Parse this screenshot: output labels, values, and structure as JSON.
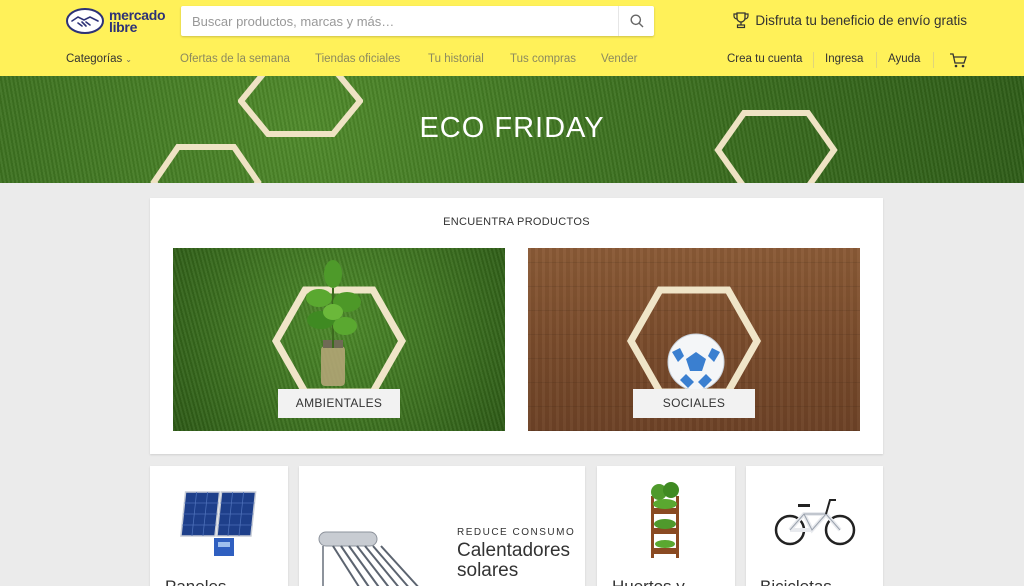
{
  "header": {
    "logo_line1": "mercado",
    "logo_line2": "libre",
    "search_placeholder": "Buscar productos, marcas y más…",
    "promo_text": "Disfruta tu beneficio de envío gratis"
  },
  "nav": {
    "categories_label": "Categorías",
    "links": [
      "Ofertas de la semana",
      "Tiendas oficiales",
      "Tu historial",
      "Tus compras",
      "Vender"
    ],
    "right_links": [
      "Crea tu cuenta",
      "Ingresa",
      "Ayuda"
    ]
  },
  "banner": {
    "title": "ECO FRIDAY"
  },
  "find": {
    "title": "ENCUENTRA PRODUCTOS",
    "tiles": [
      {
        "label": "AMBIENTALES"
      },
      {
        "label": "SOCIALES"
      }
    ]
  },
  "products": {
    "panels_label": "Paneles",
    "heaters_kicker": "REDUCE CONSUMO",
    "heaters_line1": "Calentadores",
    "heaters_line2": "solares",
    "gardens_label": "Huertos y",
    "bikes_label": "Bicicletas"
  },
  "colors": {
    "header_bg": "#fff159",
    "brand_blue": "#2d3277",
    "page_bg": "#ebebeb"
  }
}
